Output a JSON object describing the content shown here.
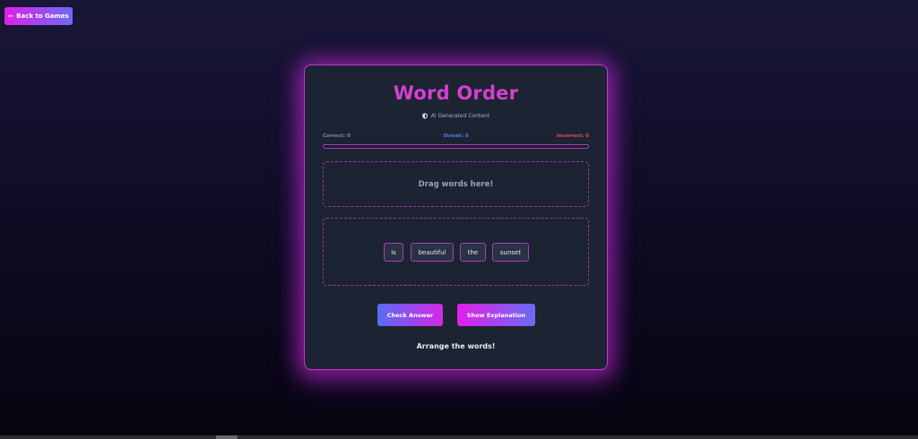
{
  "back_button": {
    "arrow": "←",
    "label": "Back to Games"
  },
  "game": {
    "title": "Word Order",
    "ai_badge": {
      "icon": "shield-icon",
      "label": "AI Generated Content"
    },
    "stats": {
      "correct": "Correct: 0",
      "streak": "Streak: 0",
      "incorrect": "Incorrect: 0"
    },
    "progress_fraction": 0,
    "drop_zone_placeholder": "Drag words here!",
    "words": [
      "is",
      "beautiful",
      "the",
      "sunset"
    ],
    "buttons": {
      "check": "Check Answer",
      "explain": "Show Explanation"
    },
    "message": "Arrange the words!"
  },
  "colors": {
    "accent_magenta": "#e020e8",
    "accent_blue": "#6a6cf2",
    "title": "#d63fcf",
    "card_background": "#1c2333",
    "streak": "#4f80e8",
    "incorrect": "#e0505a"
  }
}
